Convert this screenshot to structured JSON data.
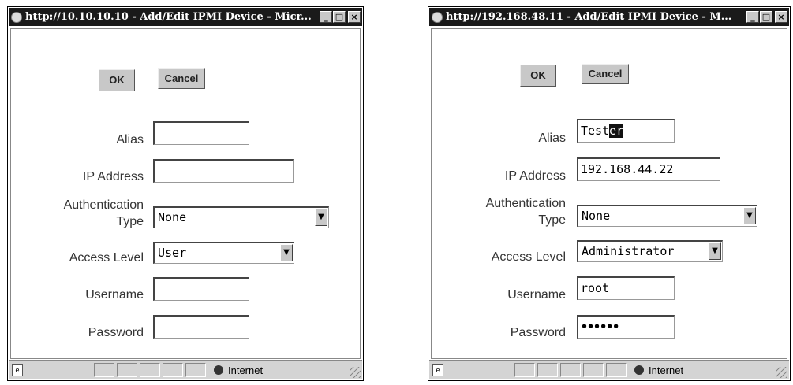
{
  "windows": [
    {
      "title": "http://10.10.10.10 - Add/Edit IPMI Device - Micr...",
      "ok_label": "OK",
      "cancel_label": "Cancel",
      "labels": {
        "alias": "Alias",
        "ip": "IP Address",
        "auth1": "Authentication",
        "auth2": "Type",
        "access": "Access Level",
        "username": "Username",
        "password": "Password"
      },
      "values": {
        "alias": "",
        "ip": "",
        "auth_type": "None",
        "access_level": "User",
        "username": "",
        "password": ""
      },
      "status": {
        "zone": "Internet"
      }
    },
    {
      "title": "http://192.168.48.11 - Add/Edit IPMI Device - M...",
      "ok_label": "OK",
      "cancel_label": "Cancel",
      "labels": {
        "alias": "Alias",
        "ip": "IP Address",
        "auth1": "Authentication",
        "auth2": "Type",
        "access": "Access Level",
        "username": "Username",
        "password": "Password"
      },
      "values": {
        "alias_plain": "Test",
        "alias_selected": "er",
        "ip": "192.168.44.22",
        "auth_type": "None",
        "access_level": "Administrator",
        "username": "root",
        "password": "••••••"
      },
      "status": {
        "zone": "Internet"
      }
    }
  ],
  "icons": {
    "minimize": "_",
    "maximize": "□",
    "close": "×",
    "dropdown": "▼"
  }
}
